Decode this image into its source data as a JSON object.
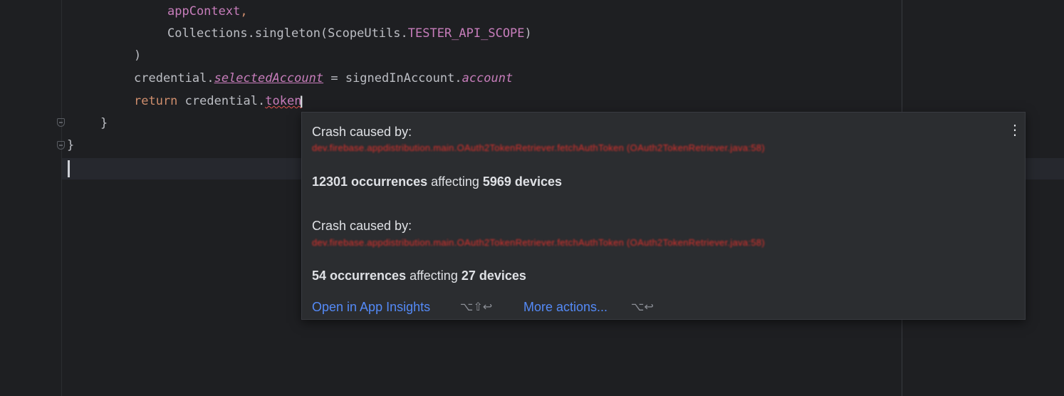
{
  "editor": {
    "lines": {
      "l1_ident": "appContext",
      "l1_comma": ",",
      "l2_prefix": "Collections.singleton(ScopeUtils.",
      "l2_const": "TESTER_API_SCOPE",
      "l2_suffix": ")",
      "l3": ")",
      "l4_obj": "credential.",
      "l4_prop": "selectedAccount",
      "l4_mid": " = signedInAccount.",
      "l4_prop2": "account",
      "l5_kw": "return",
      "l5_obj": " credential.",
      "l5_prop": "token",
      "l6": "}",
      "l7": "}"
    }
  },
  "popup": {
    "menu_icon": "more-vertical",
    "crashes": [
      {
        "label": "Crash caused by:",
        "frame": "dev.firebase.appdistribution.main.OAuth2TokenRetriever.fetchAuthToken (OAuth2TokenRetriever.java:58)",
        "occurrences": "12301 occurrences",
        "affecting": "affecting",
        "devices": "5969 devices"
      },
      {
        "label": "Crash caused by:",
        "frame": "dev.firebase.appdistribution.main.OAuth2TokenRetriever.fetchAuthToken (OAuth2TokenRetriever.java:58)",
        "occurrences": "54 occurrences",
        "affecting": "affecting",
        "devices": "27 devices"
      }
    ],
    "actions": {
      "open_label": "Open in App Insights",
      "open_shortcut": "⌥⇧↩",
      "more_label": "More actions...",
      "more_shortcut": "⌥↩"
    }
  },
  "colors": {
    "background": "#1e1f22",
    "keyword": "#cf8e6d",
    "constant": "#c77dbb",
    "link": "#548af7",
    "error": "#e0312c"
  }
}
